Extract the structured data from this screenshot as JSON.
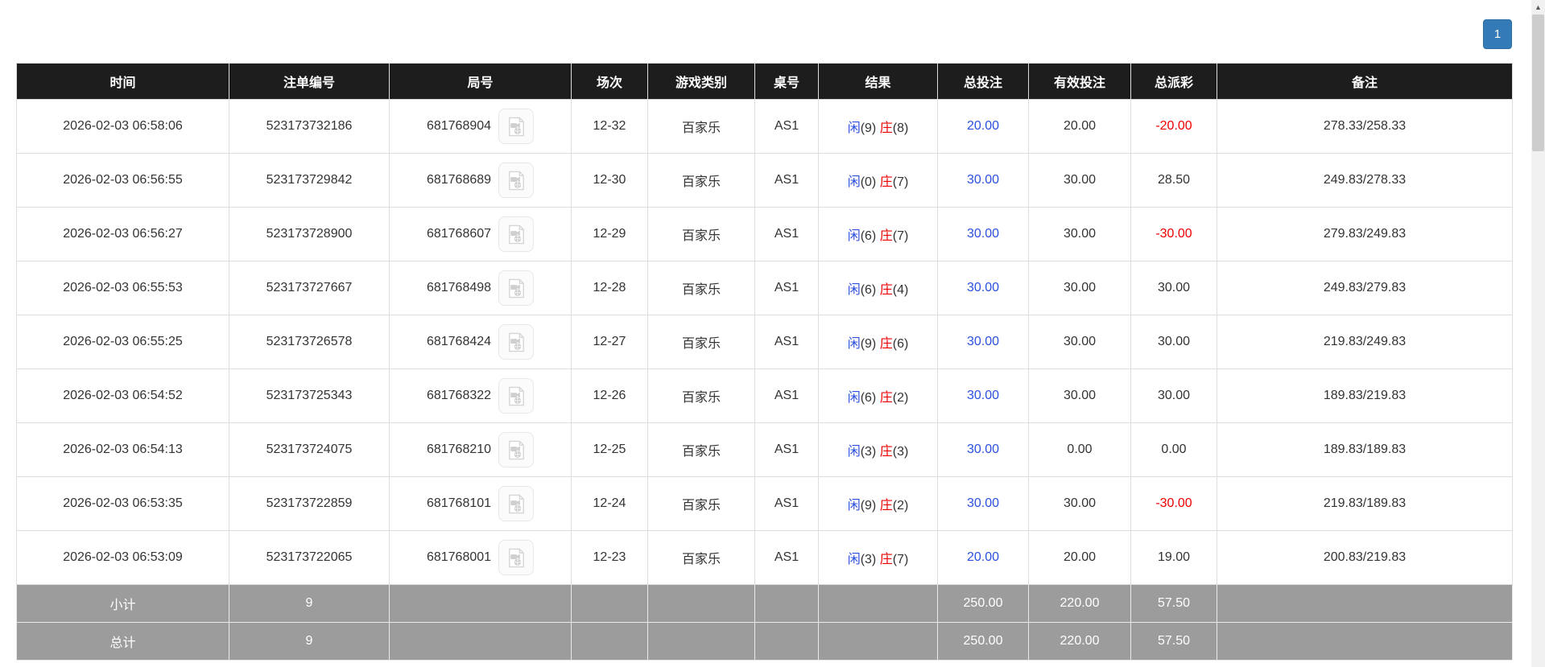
{
  "pagination": {
    "current_page": "1"
  },
  "icons": {
    "video_icon": "video-replay",
    "scroll_up_icon": "▲"
  },
  "colors": {
    "header_bg": "#1d1d1d",
    "link_blue": "#2b50e0",
    "negative_red": "#ee0000",
    "summary_bg": "#9c9c9c",
    "pagination_blue": "#337ab7"
  },
  "table": {
    "columns": [
      {
        "key": "time",
        "label": "时间"
      },
      {
        "key": "bet-id",
        "label": "注单编号"
      },
      {
        "key": "round-id",
        "label": "局号"
      },
      {
        "key": "session",
        "label": "场次"
      },
      {
        "key": "game-type",
        "label": "游戏类别"
      },
      {
        "key": "table-no",
        "label": "桌号"
      },
      {
        "key": "result",
        "label": "结果"
      },
      {
        "key": "total-bet",
        "label": "总投注"
      },
      {
        "key": "valid-bet",
        "label": "有效投注"
      },
      {
        "key": "payout",
        "label": "总派彩"
      },
      {
        "key": "remark",
        "label": "备注"
      }
    ],
    "rows": [
      {
        "time": "2026-02-03 06:58:06",
        "bet_id": "523173732186",
        "round_id": "681768904",
        "session": "12-32",
        "game_type": "百家乐",
        "table_no": "AS1",
        "result": {
          "player": "闲",
          "player_score": "(9)",
          "banker": "庄",
          "banker_score": "(8)"
        },
        "total_bet": "20.00",
        "valid_bet": "20.00",
        "payout": "-20.00",
        "remark": "278.33/258.33"
      },
      {
        "time": "2026-02-03 06:56:55",
        "bet_id": "523173729842",
        "round_id": "681768689",
        "session": "12-30",
        "game_type": "百家乐",
        "table_no": "AS1",
        "result": {
          "player": "闲",
          "player_score": "(0)",
          "banker": "庄",
          "banker_score": "(7)"
        },
        "total_bet": "30.00",
        "valid_bet": "30.00",
        "payout": "28.50",
        "remark": "249.83/278.33"
      },
      {
        "time": "2026-02-03 06:56:27",
        "bet_id": "523173728900",
        "round_id": "681768607",
        "session": "12-29",
        "game_type": "百家乐",
        "table_no": "AS1",
        "result": {
          "player": "闲",
          "player_score": "(6)",
          "banker": "庄",
          "banker_score": "(7)"
        },
        "total_bet": "30.00",
        "valid_bet": "30.00",
        "payout": "-30.00",
        "remark": "279.83/249.83"
      },
      {
        "time": "2026-02-03 06:55:53",
        "bet_id": "523173727667",
        "round_id": "681768498",
        "session": "12-28",
        "game_type": "百家乐",
        "table_no": "AS1",
        "result": {
          "player": "闲",
          "player_score": "(6)",
          "banker": "庄",
          "banker_score": "(4)"
        },
        "total_bet": "30.00",
        "valid_bet": "30.00",
        "payout": "30.00",
        "remark": "249.83/279.83"
      },
      {
        "time": "2026-02-03 06:55:25",
        "bet_id": "523173726578",
        "round_id": "681768424",
        "session": "12-27",
        "game_type": "百家乐",
        "table_no": "AS1",
        "result": {
          "player": "闲",
          "player_score": "(9)",
          "banker": "庄",
          "banker_score": "(6)"
        },
        "total_bet": "30.00",
        "valid_bet": "30.00",
        "payout": "30.00",
        "remark": "219.83/249.83"
      },
      {
        "time": "2026-02-03 06:54:52",
        "bet_id": "523173725343",
        "round_id": "681768322",
        "session": "12-26",
        "game_type": "百家乐",
        "table_no": "AS1",
        "result": {
          "player": "闲",
          "player_score": "(6)",
          "banker": "庄",
          "banker_score": "(2)"
        },
        "total_bet": "30.00",
        "valid_bet": "30.00",
        "payout": "30.00",
        "remark": "189.83/219.83"
      },
      {
        "time": "2026-02-03 06:54:13",
        "bet_id": "523173724075",
        "round_id": "681768210",
        "session": "12-25",
        "game_type": "百家乐",
        "table_no": "AS1",
        "result": {
          "player": "闲",
          "player_score": "(3)",
          "banker": "庄",
          "banker_score": "(3)"
        },
        "total_bet": "30.00",
        "valid_bet": "0.00",
        "payout": "0.00",
        "remark": "189.83/189.83"
      },
      {
        "time": "2026-02-03 06:53:35",
        "bet_id": "523173722859",
        "round_id": "681768101",
        "session": "12-24",
        "game_type": "百家乐",
        "table_no": "AS1",
        "result": {
          "player": "闲",
          "player_score": "(9)",
          "banker": "庄",
          "banker_score": "(2)"
        },
        "total_bet": "30.00",
        "valid_bet": "30.00",
        "payout": "-30.00",
        "remark": "219.83/189.83"
      },
      {
        "time": "2026-02-03 06:53:09",
        "bet_id": "523173722065",
        "round_id": "681768001",
        "session": "12-23",
        "game_type": "百家乐",
        "table_no": "AS1",
        "result": {
          "player": "闲",
          "player_score": "(3)",
          "banker": "庄",
          "banker_score": "(7)"
        },
        "total_bet": "20.00",
        "valid_bet": "20.00",
        "payout": "19.00",
        "remark": "200.83/219.83"
      }
    ],
    "subtotal": {
      "label": "小计",
      "count": "9",
      "total_bet": "250.00",
      "valid_bet": "220.00",
      "payout": "57.50"
    },
    "total": {
      "label": "总计",
      "count": "9",
      "total_bet": "250.00",
      "valid_bet": "220.00",
      "payout": "57.50"
    }
  }
}
